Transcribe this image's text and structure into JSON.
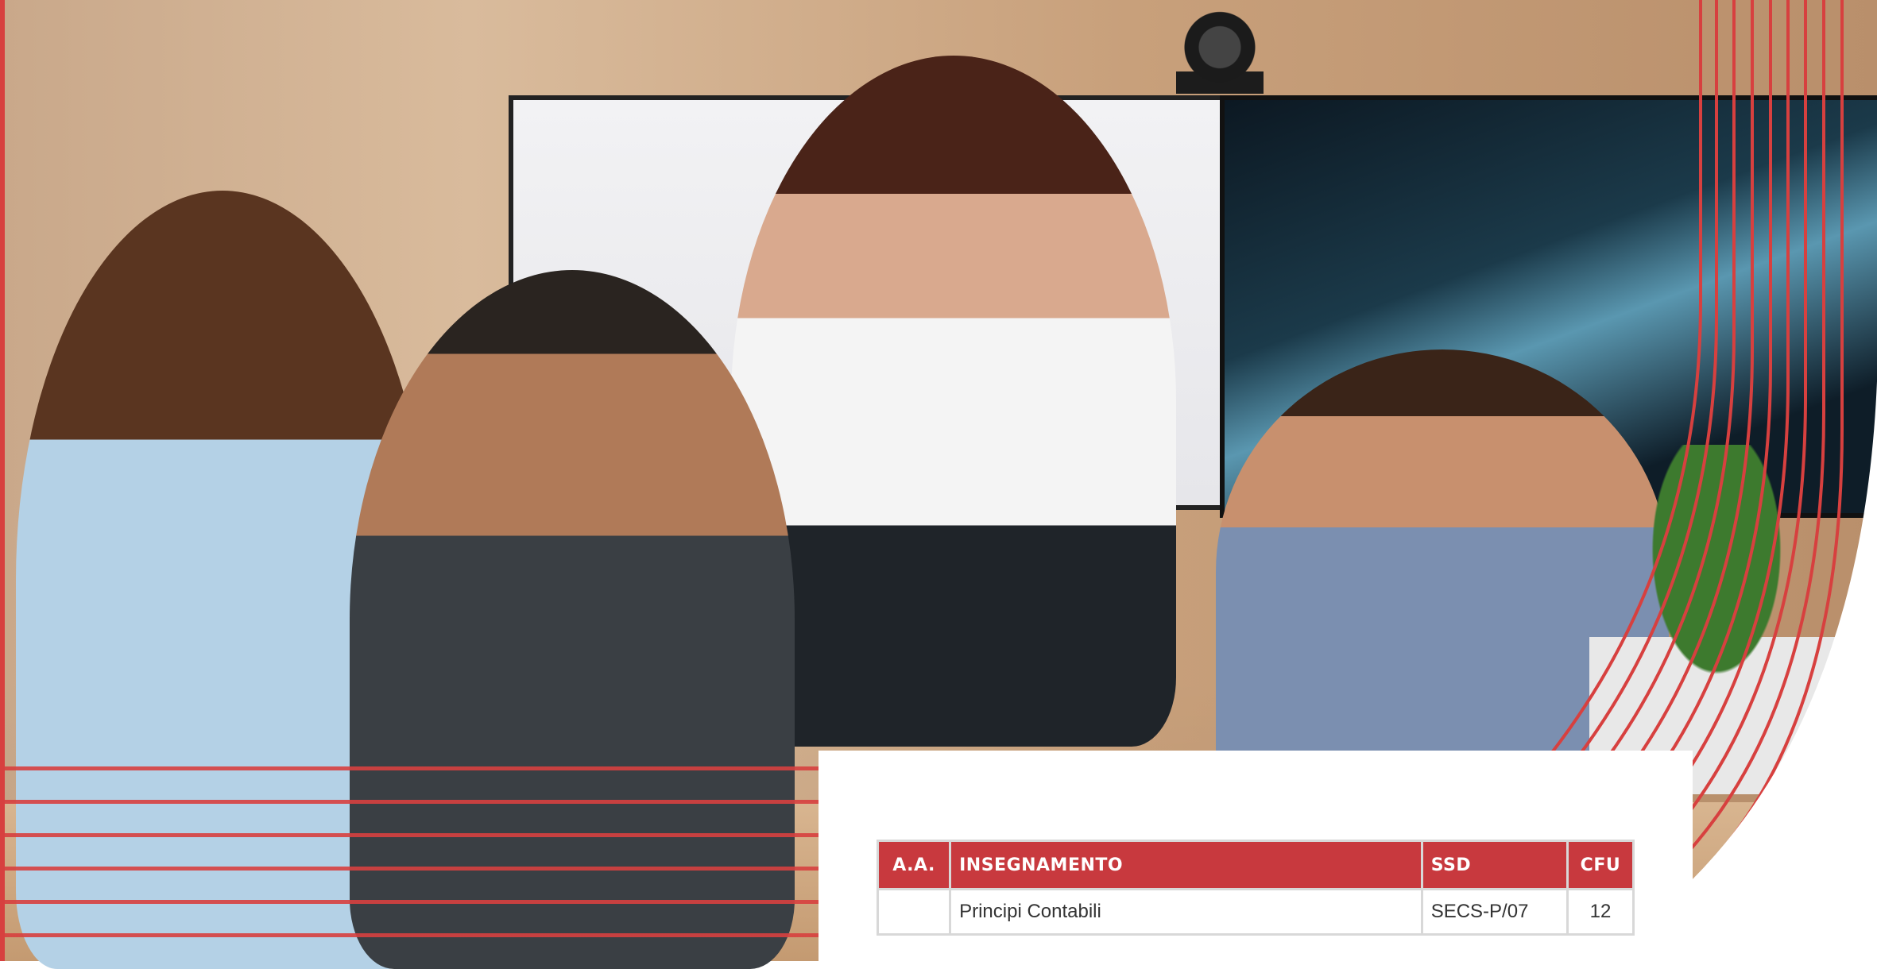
{
  "colors": {
    "accent_red": "#c8393e",
    "stripe_red": "#d7403f",
    "table_border": "#d8d8d8",
    "text": "#333333"
  },
  "photo": {
    "icon": "group-meeting-photo"
  },
  "table": {
    "headers": {
      "aa": "A.A.",
      "insegnamento": "INSEGNAMENTO",
      "ssd": "SSD",
      "cfu": "CFU"
    },
    "rows": [
      {
        "aa": "",
        "insegnamento": "Principi Contabili",
        "ssd": "SECS-P/07",
        "cfu": "12"
      }
    ]
  }
}
